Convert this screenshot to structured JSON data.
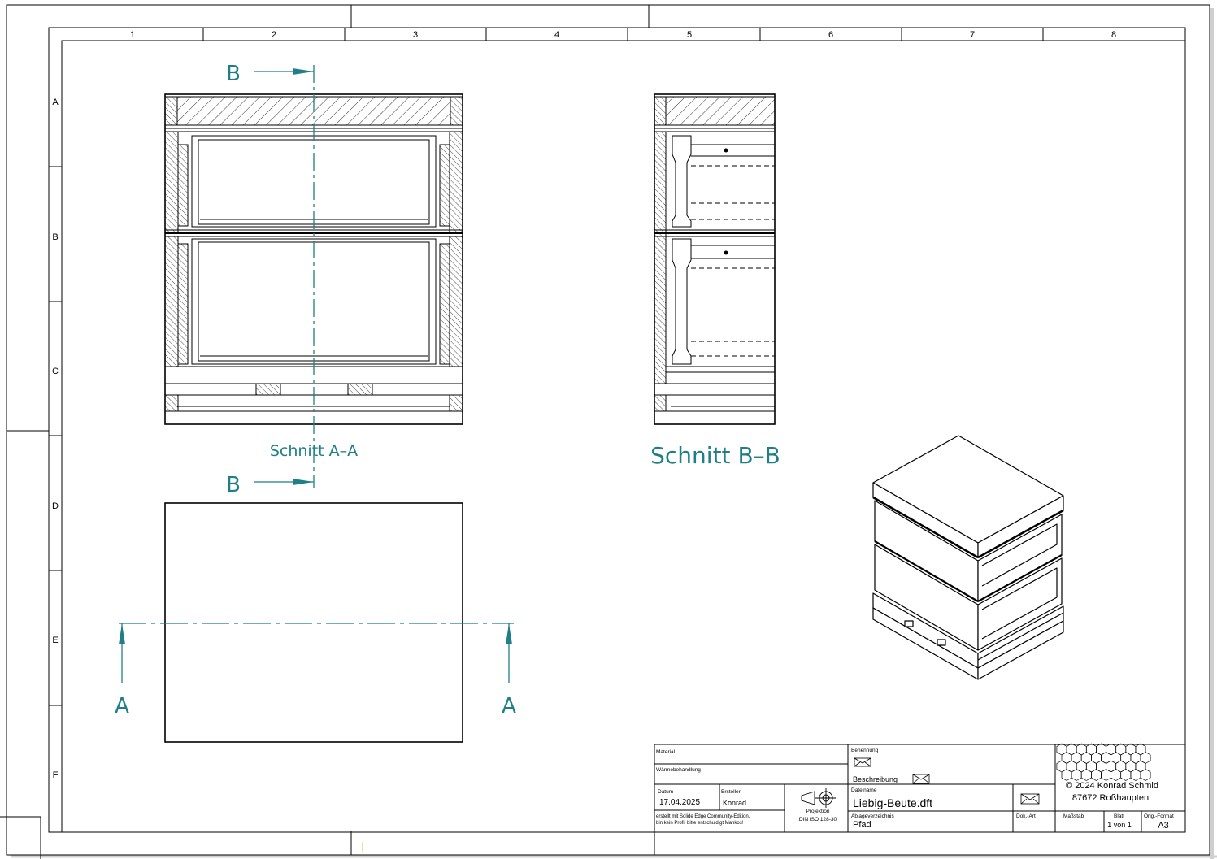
{
  "sheet": {
    "zone_columns": [
      "1",
      "2",
      "3",
      "4",
      "5",
      "6",
      "7",
      "8"
    ],
    "zone_rows": [
      "A",
      "B",
      "C",
      "D",
      "E",
      "F"
    ]
  },
  "views": {
    "section_aa": {
      "label": "Schnitt  A–A",
      "cut_letter": "B"
    },
    "section_bb": {
      "label": "Schnitt  B–B"
    },
    "top_view": {
      "cut_letter": "A"
    }
  },
  "title_block": {
    "material_label": "Material",
    "heat_treatment_label": "Wärmebehandlung",
    "date_label": "Datum",
    "date_value": "17.04.2025",
    "author_label": "Ersteller",
    "author_value": "Konrad",
    "note_line1": "erstellt mit Solide Edge Community-Edition,",
    "note_line2": "bin kein Profi, bitte entschuldigt Mankos!",
    "projection_label": "Projektion",
    "projection_standard": "DIN ISO 128-30",
    "name_label": "Benennung",
    "description_label": "Beschreibung",
    "filename_label": "Dateiname",
    "filename_value": "Liebig-Beute.dft",
    "folder_label": "Ablageverzeichnis",
    "folder_value": "Pfad",
    "doc_type_label": "Dok.-Art",
    "scale_label": "Maßstab",
    "sheet_label": "Blatt",
    "sheet_value": "1 von 1",
    "format_label": "Orig.-Format",
    "format_value": "A3",
    "copyright_line1": "© 2024 Konrad Schmid",
    "copyright_line2": "87672 Roßhaupten"
  },
  "colors": {
    "accent": "#1e7f86",
    "line": "#000000",
    "background": "#ffffff"
  },
  "icons": [
    "envelope-icon",
    "projection-symbol-icon",
    "honeycomb-logo"
  ]
}
